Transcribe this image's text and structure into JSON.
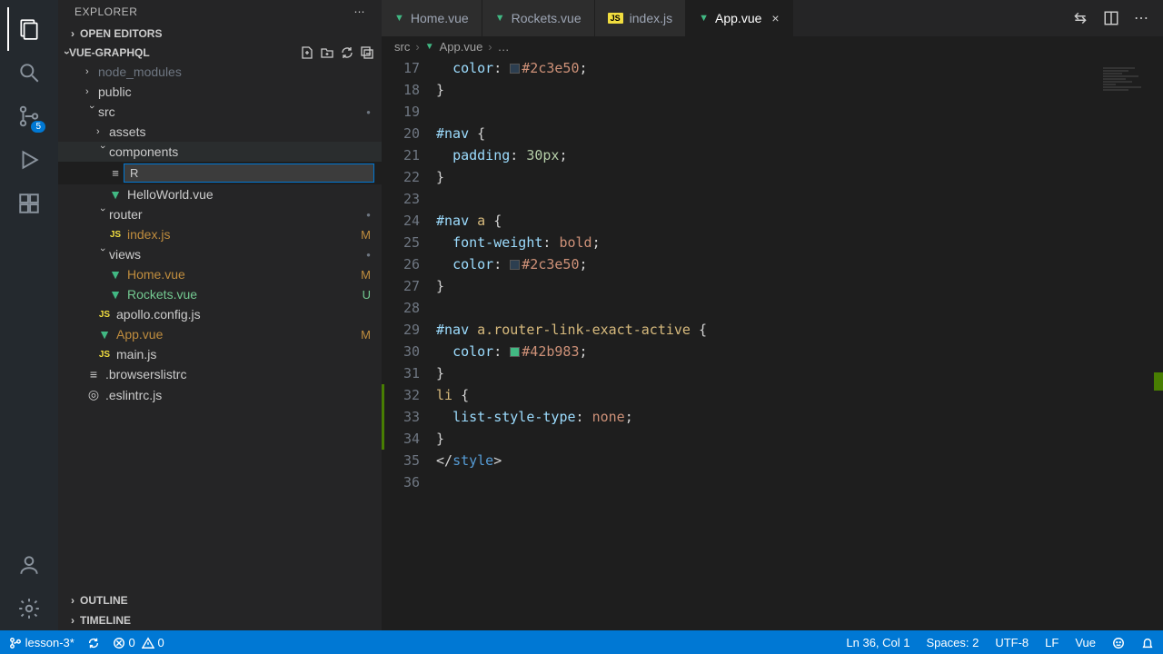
{
  "sidebar": {
    "title": "EXPLORER",
    "sections": {
      "open_editors": "OPEN EDITORS",
      "outline": "OUTLINE",
      "timeline": "TIMELINE"
    },
    "project_name": "VUE-GRAPHQL",
    "tree": {
      "node_modules": "node_modules",
      "public": "public",
      "src": "src",
      "assets": "assets",
      "components": "components",
      "new_file_value": "R",
      "hello_world": "HelloWorld.vue",
      "router": "router",
      "router_index": "index.js",
      "router_index_status": "M",
      "views": "views",
      "home_vue": "Home.vue",
      "home_vue_status": "M",
      "rockets_vue": "Rockets.vue",
      "rockets_vue_status": "U",
      "apollo_config": "apollo.config.js",
      "app_vue": "App.vue",
      "app_vue_status": "M",
      "main_js": "main.js",
      "browserslistrc": ".browserslistrc",
      "eslintrc": ".eslintrc.js"
    }
  },
  "activity": {
    "scm_badge": "5"
  },
  "tabs": [
    {
      "label": "Home.vue",
      "icon": "vue"
    },
    {
      "label": "Rockets.vue",
      "icon": "vue"
    },
    {
      "label": "index.js",
      "icon": "js"
    },
    {
      "label": "App.vue",
      "icon": "vue",
      "active": true
    }
  ],
  "breadcrumb": {
    "seg0": "src",
    "seg1": "App.vue",
    "seg2": "…"
  },
  "code_lines": [
    {
      "n": 17,
      "html": "  <span class='prop'>color</span><span class='punc'>:</span> <span class='swatch' style='background:#2c3e50'></span><span class='val'>#2c3e50</span><span class='punc'>;</span>"
    },
    {
      "n": 18,
      "html": "<span class='punc'>}</span>"
    },
    {
      "n": 19,
      "html": ""
    },
    {
      "n": 20,
      "html": "<span class='sel'>#nav</span> <span class='punc'>{</span>"
    },
    {
      "n": 21,
      "html": "  <span class='prop'>padding</span><span class='punc'>:</span> <span class='num'>30px</span><span class='punc'>;</span>"
    },
    {
      "n": 22,
      "html": "<span class='punc'>}</span>"
    },
    {
      "n": 23,
      "html": ""
    },
    {
      "n": 24,
      "html": "<span class='sel'>#nav</span> <span class='cls'>a</span> <span class='punc'>{</span>"
    },
    {
      "n": 25,
      "html": "  <span class='prop'>font-weight</span><span class='punc'>:</span> <span class='val'>bold</span><span class='punc'>;</span>"
    },
    {
      "n": 26,
      "html": "  <span class='prop'>color</span><span class='punc'>:</span> <span class='swatch' style='background:#2c3e50'></span><span class='val'>#2c3e50</span><span class='punc'>;</span>"
    },
    {
      "n": 27,
      "html": "<span class='punc'>}</span>"
    },
    {
      "n": 28,
      "html": ""
    },
    {
      "n": 29,
      "html": "<span class='sel'>#nav</span> <span class='cls'>a.router-link-exact-active</span> <span class='punc'>{</span>"
    },
    {
      "n": 30,
      "html": "  <span class='prop'>color</span><span class='punc'>:</span> <span class='swatch' style='background:#42b983'></span><span class='val'>#42b983</span><span class='punc'>;</span>"
    },
    {
      "n": 31,
      "html": "<span class='punc'>}</span>"
    },
    {
      "n": 32,
      "html": "<span class='cls'>li</span> <span class='punc'>{</span>"
    },
    {
      "n": 33,
      "html": "  <span class='prop'>list-style-type</span><span class='punc'>:</span> <span class='val'>none</span><span class='punc'>;</span>"
    },
    {
      "n": 34,
      "html": "<span class='punc'>}</span>"
    },
    {
      "n": 35,
      "html": "<span class='punc'>&lt;/</span><span class='tag'>style</span><span class='punc'>&gt;</span>"
    },
    {
      "n": 36,
      "html": ""
    }
  ],
  "status": {
    "branch": "lesson-3*",
    "errors": "0",
    "warnings": "0",
    "cursor": "Ln 36, Col 1",
    "spaces": "Spaces: 2",
    "encoding": "UTF-8",
    "eol": "LF",
    "lang": "Vue"
  }
}
